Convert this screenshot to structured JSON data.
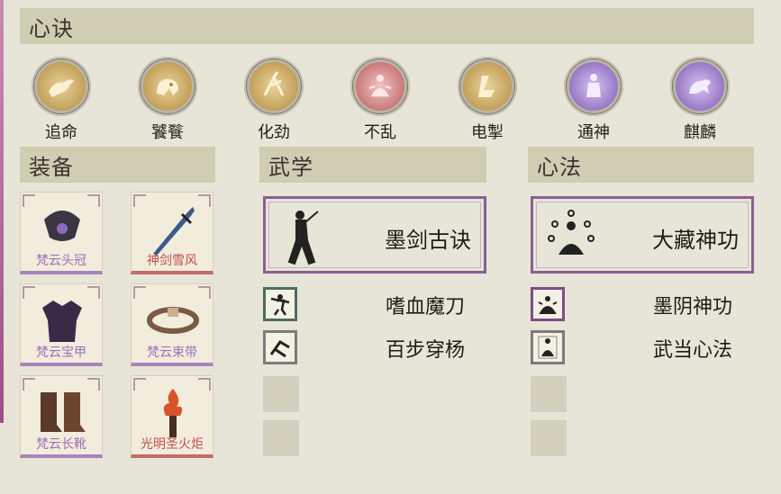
{
  "sections": {
    "xinjue": "心诀",
    "zhuangbei": "装备",
    "wuxue": "武学",
    "xinfa": "心法"
  },
  "skills": [
    {
      "label": "追命",
      "icon": "running-beast-icon",
      "color": "#c9a25a"
    },
    {
      "label": "饕餮",
      "icon": "taotie-beast-icon",
      "color": "#c9a25a"
    },
    {
      "label": "化劲",
      "icon": "swirling-figure-icon",
      "color": "#c9a25a"
    },
    {
      "label": "不乱",
      "icon": "meditating-figure-icon",
      "color": "#c46a6a"
    },
    {
      "label": "电掣",
      "icon": "lightning-icon",
      "color": "#c9a25a"
    },
    {
      "label": "通神",
      "icon": "deity-icon",
      "color": "#9b74c4"
    },
    {
      "label": "麒麟",
      "icon": "qilin-icon",
      "color": "#9b74c4"
    }
  ],
  "equipment": [
    {
      "name": "梵云头冠",
      "icon": "crown-icon",
      "rarity": "purple"
    },
    {
      "name": "神剑雪风",
      "icon": "sword-icon",
      "rarity": "red"
    },
    {
      "name": "梵云宝甲",
      "icon": "armor-icon",
      "rarity": "purple"
    },
    {
      "name": "梵云束带",
      "icon": "belt-icon",
      "rarity": "purple"
    },
    {
      "name": "梵云长靴",
      "icon": "boots-icon",
      "rarity": "purple"
    },
    {
      "name": "光明圣火炬",
      "icon": "torch-icon",
      "rarity": "red"
    }
  ],
  "wuxue": {
    "main": "墨剑古诀",
    "items": [
      "嗜血魔刀",
      "百步穿杨"
    ]
  },
  "xinfa": {
    "main": "大藏神功",
    "items": [
      "墨阴神功",
      "武当心法"
    ]
  }
}
